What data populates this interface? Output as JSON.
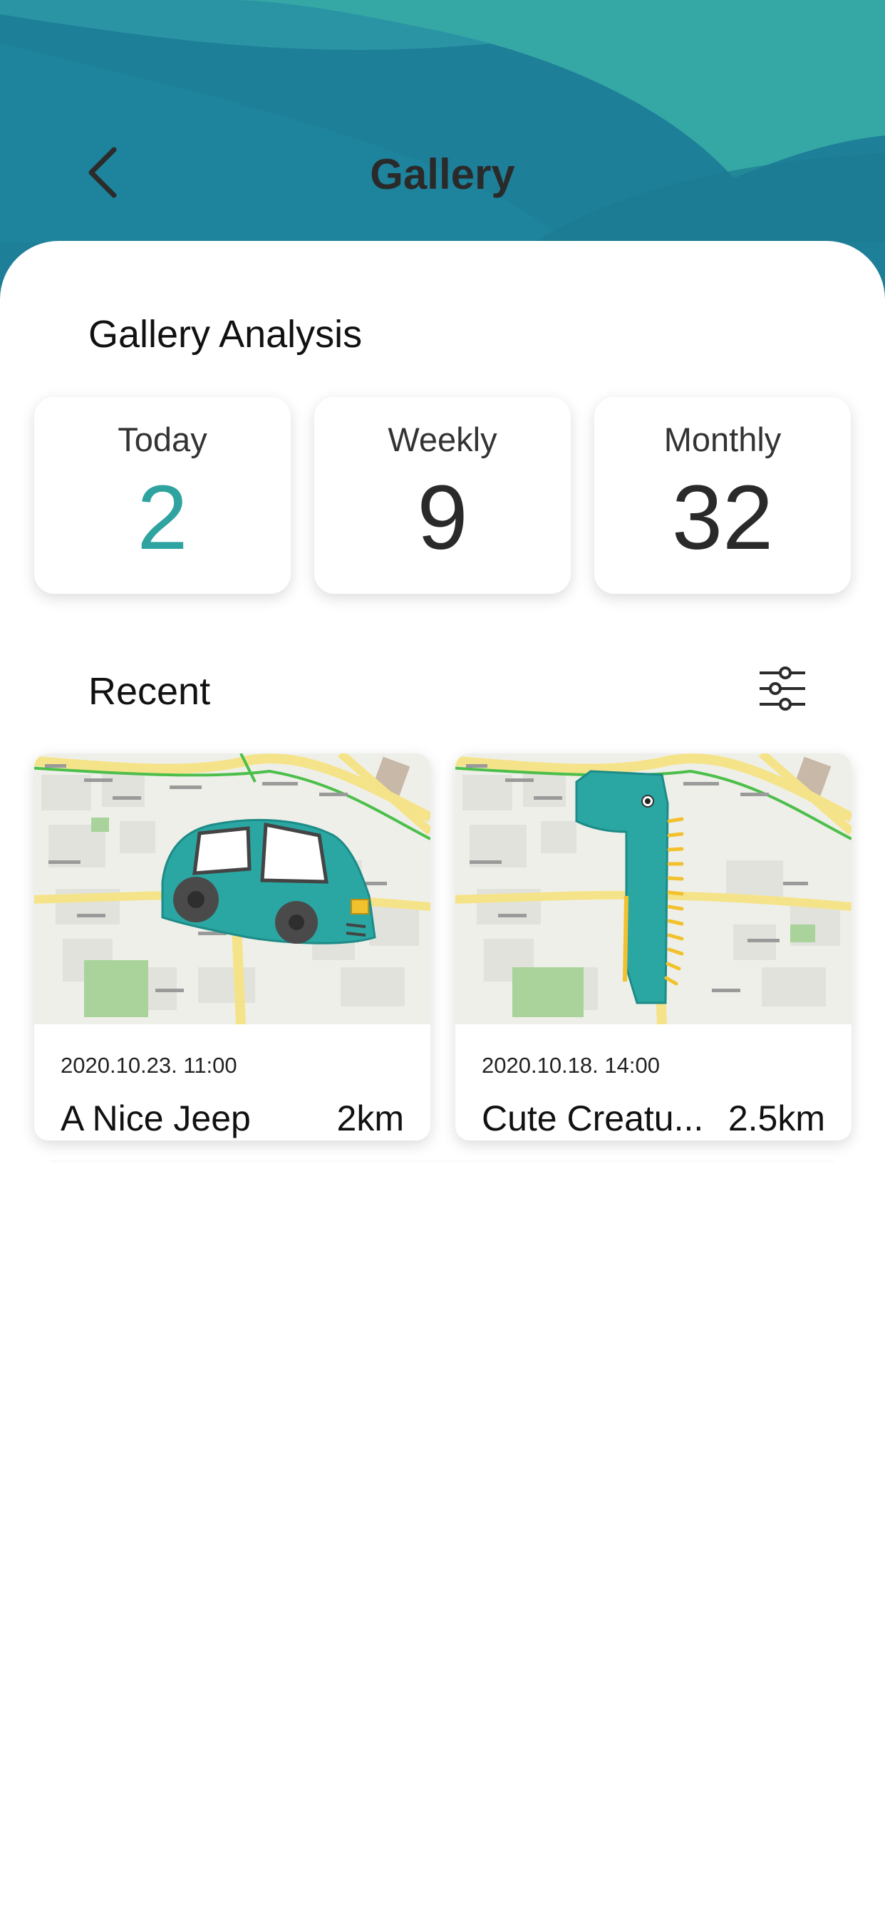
{
  "header": {
    "title": "Gallery",
    "back_icon": "chevron-left-icon",
    "colors": {
      "wave_dark": "#1c7f9a",
      "wave_mid": "#2593a3",
      "wave_light": "#34a9a5"
    }
  },
  "analysis": {
    "title": "Gallery Analysis",
    "stats": [
      {
        "label": "Today",
        "value": "2",
        "color": "#2fa3a0"
      },
      {
        "label": "Weekly",
        "value": "9",
        "color": "#2a2a2a"
      },
      {
        "label": "Monthly",
        "value": "32",
        "color": "#2a2a2a"
      }
    ]
  },
  "recent": {
    "title": "Recent",
    "filter_icon": "sliders-icon",
    "items": [
      {
        "date": "2020.10.23. 11:00",
        "title": "A Nice Jeep",
        "distance": "2km",
        "drawing": "car-drawing"
      },
      {
        "date": "2020.10.18. 14:00",
        "title": "Cute Creatu...",
        "distance": "2.5km",
        "drawing": "creature-drawing"
      }
    ]
  }
}
